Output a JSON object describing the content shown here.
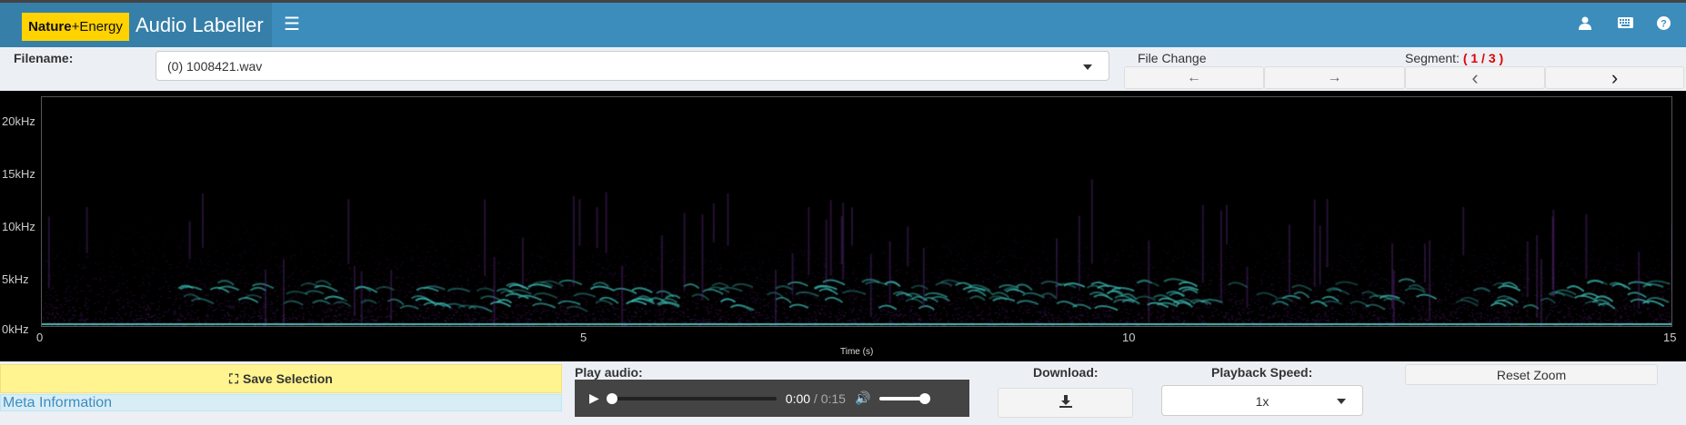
{
  "header": {
    "logo_text_bold": "Nature",
    "logo_text_rest": "+Energy",
    "title": "Audio Labeller",
    "menu_icon": "hamburger-icon",
    "icons": [
      "user-icon",
      "keyboard-icon",
      "help-icon"
    ]
  },
  "file": {
    "label": "Filename:",
    "value": "(0) 1008421.wav"
  },
  "file_change": {
    "label": "File Change",
    "prev": "←",
    "next": "→"
  },
  "segment": {
    "label": "Segment:",
    "value": "( 1 / 3 )",
    "prev": "‹",
    "next": "›"
  },
  "spectrogram": {
    "y_ticks": [
      "20kHz",
      "15kHz",
      "10kHz",
      "5kHz",
      "0kHz"
    ],
    "x_ticks": [
      "0",
      "5",
      "10",
      "15"
    ],
    "x_label": "Time (s)",
    "x_range": [
      0,
      15
    ],
    "y_range_khz": [
      0,
      21
    ]
  },
  "save_selection": "Save Selection",
  "meta_information": "Meta Information",
  "play_audio": {
    "label": "Play audio:",
    "current": "0:00",
    "separator": " / ",
    "duration": "0:15",
    "progress": 0,
    "volume": 1
  },
  "download": {
    "label": "Download:"
  },
  "playback_speed": {
    "label": "Playback Speed:",
    "value": "1x"
  },
  "reset_zoom": "Reset Zoom",
  "colors": {
    "header": "#3c8dbc",
    "logo": "#ffd200",
    "save": "#fff48f",
    "segment": "#e00000"
  }
}
